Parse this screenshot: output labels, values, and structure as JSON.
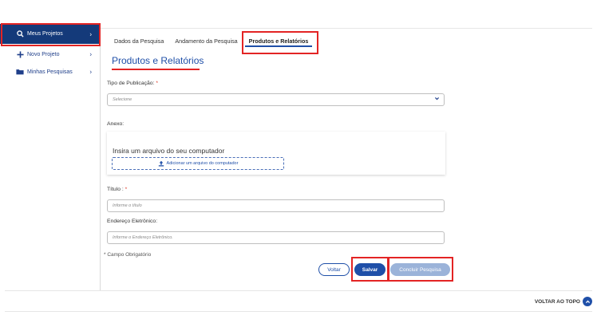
{
  "sidebar": {
    "items": [
      {
        "label": "Meus Projetos",
        "icon": "search-icon"
      },
      {
        "label": "Novo Projeto",
        "icon": "plus-icon"
      },
      {
        "label": "Minhas Pesquisas",
        "icon": "folder-icon"
      }
    ]
  },
  "tabs": [
    {
      "label": "Dados da Pesquisa"
    },
    {
      "label": "Andamento da Pesquisa"
    },
    {
      "label": "Produtos e Relatórios"
    }
  ],
  "page": {
    "title": "Produtos e Relatórios"
  },
  "form": {
    "publication_type_label": "Tipo de Publicação:",
    "required_mark": "*",
    "publication_type_placeholder": "Selecione",
    "attachment_label": "Anexo:",
    "upload_text": "Insira um arquivo do seu computador",
    "upload_button_label": "Adicionar um arquivo do computador",
    "title_label": "Título :",
    "title_placeholder": "Informe o título",
    "email_label": "Endereço Eletrônico:",
    "email_placeholder": "Informe o Endereço Eletrônico.",
    "required_note": "* Campo Obrigatório"
  },
  "actions": {
    "back_label": "Voltar",
    "save_label": "Salvar",
    "finish_label": "Concluir Pesquisa"
  },
  "footer": {
    "back_to_top_label": "VOLTAR AO TOPO"
  },
  "colors": {
    "primary": "#1f4fa8",
    "sidebar_active": "#143a7a",
    "highlight": "#e32424",
    "finish_disabled": "#9bb3d9"
  }
}
